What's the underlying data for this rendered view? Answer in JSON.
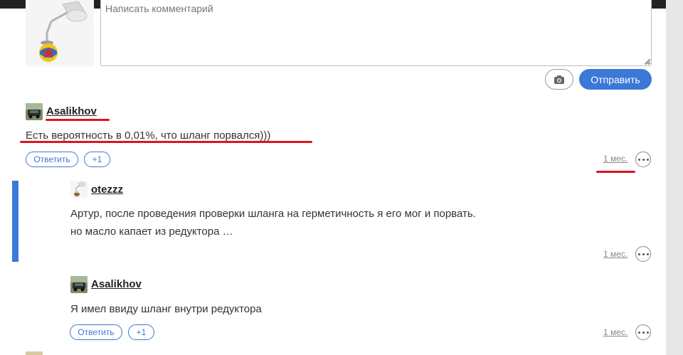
{
  "compose": {
    "placeholder": "Написать комментарий",
    "send_label": "Отправить"
  },
  "comments": [
    {
      "user": "Asalikhov",
      "text": "Есть вероятность в 0,01%, что шланг порвался)))",
      "reply_label": "Ответить",
      "plus_label": "+1",
      "time": "1 мес."
    },
    {
      "user": "otezzz",
      "text_line1": "Артур, после проведения проверки шланга на герметичность я его мог и порвать.",
      "text_line2": "но масло капает из редуктора …",
      "time": "1 мес."
    },
    {
      "user": "Asalikhov",
      "text": "Я имел ввиду шланг внутри редуктора",
      "reply_label": "Ответить",
      "plus_label": "+1",
      "time": "1 мес."
    }
  ],
  "colors": {
    "accent": "#3b78d8",
    "annotation": "#e0121f"
  },
  "icons": {
    "photo": "camera-icon",
    "more": "more-dots-icon"
  }
}
